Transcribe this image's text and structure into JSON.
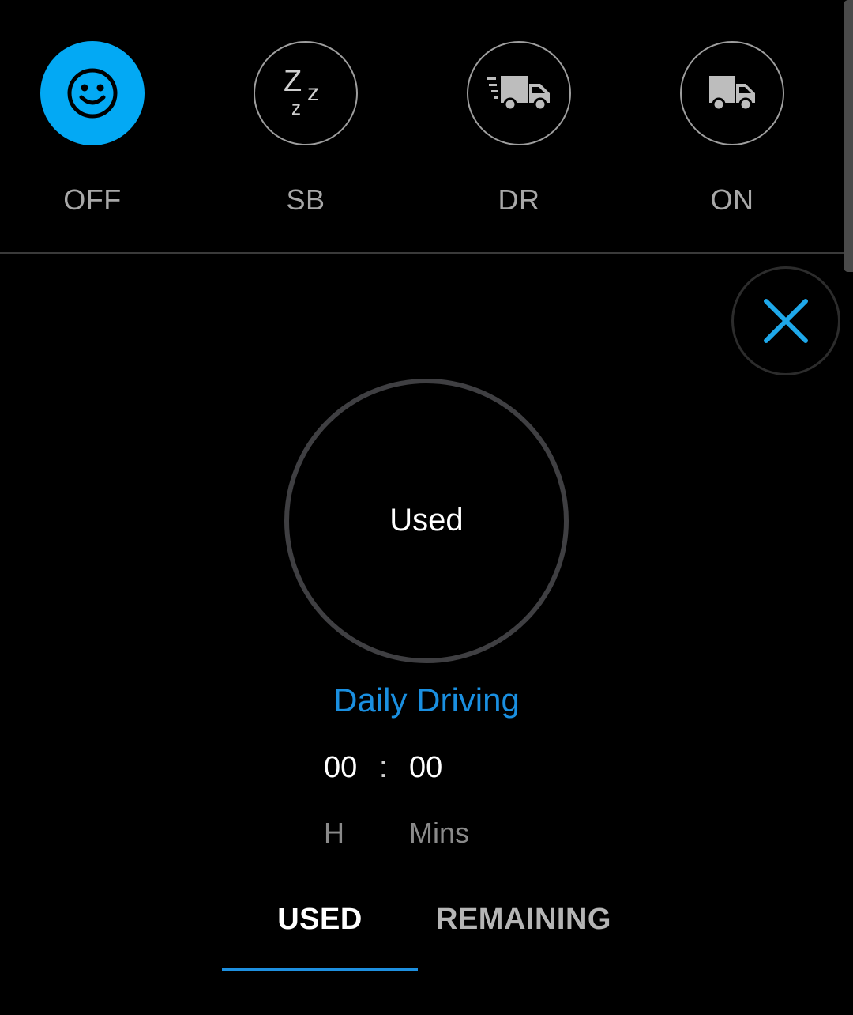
{
  "statuses": [
    {
      "code": "OFF",
      "icon": "smiley-icon",
      "active": true
    },
    {
      "code": "SB",
      "icon": "sleep-zzz-icon",
      "active": false
    },
    {
      "code": "DR",
      "icon": "moving-truck-icon",
      "active": false
    },
    {
      "code": "ON",
      "icon": "truck-icon",
      "active": false
    }
  ],
  "gauge": {
    "label": "Used"
  },
  "metric": {
    "title": "Daily Driving",
    "hours": "00",
    "separator": ":",
    "minutes": "00",
    "hours_unit": "H",
    "minutes_unit": "Mins"
  },
  "tabs": [
    {
      "label": "USED",
      "selected": true
    },
    {
      "label": "REMAINING",
      "selected": false
    }
  ],
  "colors": {
    "accent": "#03a9f4",
    "title_blue": "#1a8fe0",
    "background": "#000000",
    "ring": "#3f3f42"
  }
}
